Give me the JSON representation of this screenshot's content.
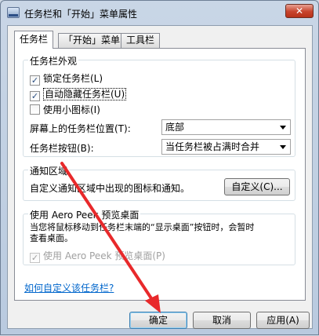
{
  "window": {
    "title": "任务栏和「开始」菜单属性",
    "close_label": "✕"
  },
  "tabs": [
    {
      "label": "任务栏"
    },
    {
      "label": "「开始」菜单"
    },
    {
      "label": "工具栏"
    }
  ],
  "appearance": {
    "title": "任务栏外观",
    "lock": {
      "label": "锁定任务栏(L)",
      "checked": true
    },
    "autohide": {
      "label": "自动隐藏任务栏(U)",
      "checked": true
    },
    "small_icons": {
      "label": "使用小图标(I)",
      "checked": false
    },
    "location_label": "屏幕上的任务栏位置(T):",
    "location_value": "底部",
    "buttons_label": "任务栏按钮(B):",
    "buttons_value": "当任务栏被占满时合并"
  },
  "notification": {
    "title": "通知区域",
    "description": "自定义通知区域中出现的图标和通知。",
    "customize_button": "自定义(C)..."
  },
  "aero": {
    "title": "使用 Aero Peek 预览桌面",
    "description_line1": "当您将鼠标移动到任务栏末端的“显示桌面”按钮时，会暂时",
    "description_line2": "查看桌面。",
    "checkbox_label": "使用 Aero Peek 预览桌面(P)",
    "checked": true
  },
  "help_link": "如何自定义该任务栏?",
  "footer": {
    "ok": "确定",
    "cancel": "取消",
    "apply": "应用(A)"
  },
  "annotation": {
    "color": "#e8292b"
  }
}
